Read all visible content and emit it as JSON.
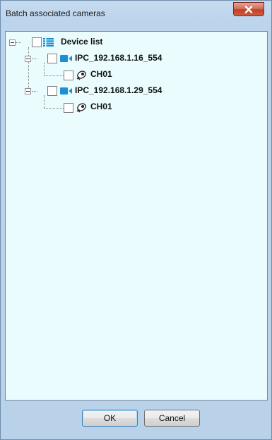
{
  "window": {
    "title": "Batch associated cameras",
    "close_label": "x"
  },
  "tree": {
    "root": {
      "label": "Device list",
      "icon": "list-icon",
      "checked": false,
      "expanded": true
    },
    "devices": [
      {
        "label": "IPC_192.168.1.16_554",
        "icon": "camera-icon",
        "checked": false,
        "expanded": true,
        "channels": [
          {
            "label": "CH01",
            "icon": "cctv-channel-icon",
            "checked": false
          }
        ]
      },
      {
        "label": "IPC_192.168.1.29_554",
        "icon": "camera-icon",
        "checked": false,
        "expanded": true,
        "channels": [
          {
            "label": "CH01",
            "icon": "cctv-channel-icon",
            "checked": false
          }
        ]
      }
    ]
  },
  "buttons": {
    "ok_label": "OK",
    "cancel_label": "Cancel"
  },
  "colors": {
    "tree_background": "#eafcfd",
    "camera_blue": "#1a8fd3",
    "close_red": "#c0412a"
  }
}
